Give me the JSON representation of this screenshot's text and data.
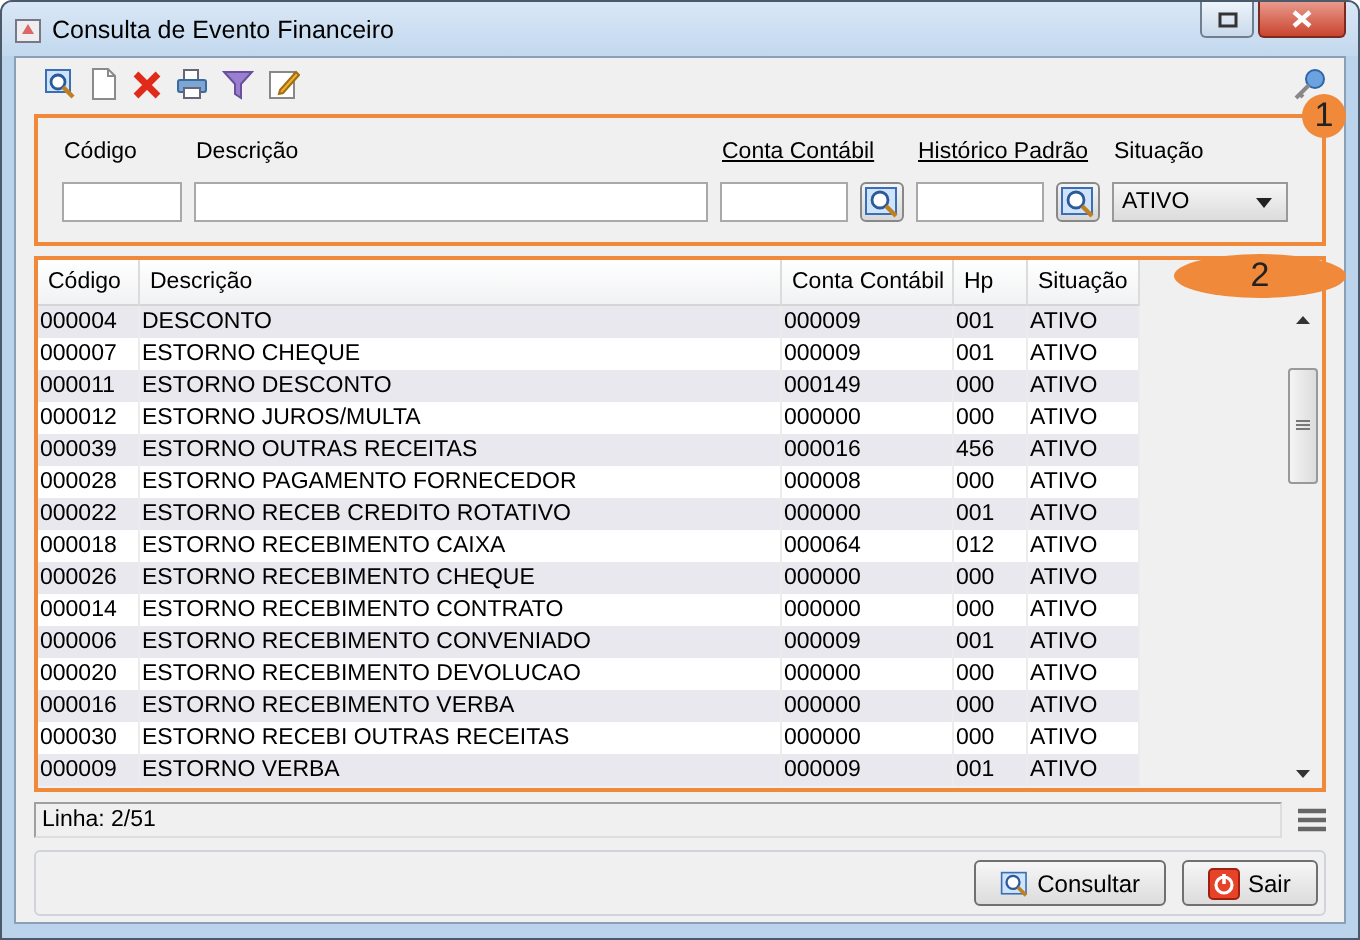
{
  "window": {
    "title": "Consulta de Evento Financeiro"
  },
  "filters": {
    "callout": "1",
    "fields": [
      {
        "kind": "text",
        "label": "Código",
        "link": false
      },
      {
        "kind": "text",
        "label": "Descrição",
        "link": false
      },
      {
        "kind": "lookup",
        "label": "Conta Contábil",
        "link": true
      },
      {
        "kind": "lookup",
        "label": "Histórico Padrão",
        "link": true
      },
      {
        "kind": "select",
        "label": "Situação",
        "link": false,
        "value": "ATIVO"
      }
    ]
  },
  "table": {
    "callout": "2",
    "columns": [
      "Código",
      "Descrição",
      "Conta Contábil",
      "Hp",
      "Situação"
    ],
    "rows": [
      [
        "000004",
        "DESCONTO",
        "000009",
        "001",
        "ATIVO"
      ],
      [
        "000007",
        "ESTORNO CHEQUE",
        "000009",
        "001",
        "ATIVO"
      ],
      [
        "000011",
        "ESTORNO DESCONTO",
        "000149",
        "000",
        "ATIVO"
      ],
      [
        "000012",
        "ESTORNO JUROS/MULTA",
        "000000",
        "000",
        "ATIVO"
      ],
      [
        "000039",
        "ESTORNO OUTRAS RECEITAS",
        "000016",
        "456",
        "ATIVO"
      ],
      [
        "000028",
        "ESTORNO PAGAMENTO FORNECEDOR",
        "000008",
        "000",
        "ATIVO"
      ],
      [
        "000022",
        "ESTORNO RECEB CREDITO ROTATIVO",
        "000000",
        "001",
        "ATIVO"
      ],
      [
        "000018",
        "ESTORNO RECEBIMENTO CAIXA",
        "000064",
        "012",
        "ATIVO"
      ],
      [
        "000026",
        "ESTORNO RECEBIMENTO CHEQUE",
        "000000",
        "000",
        "ATIVO"
      ],
      [
        "000014",
        "ESTORNO RECEBIMENTO CONTRATO",
        "000000",
        "000",
        "ATIVO"
      ],
      [
        "000006",
        "ESTORNO RECEBIMENTO CONVENIADO",
        "000009",
        "001",
        "ATIVO"
      ],
      [
        "000020",
        "ESTORNO RECEBIMENTO DEVOLUCAO",
        "000000",
        "000",
        "ATIVO"
      ],
      [
        "000016",
        "ESTORNO RECEBIMENTO VERBA",
        "000000",
        "000",
        "ATIVO"
      ],
      [
        "000030",
        "ESTORNO RECEBI OUTRAS RECEITAS",
        "000000",
        "000",
        "ATIVO"
      ],
      [
        "000009",
        "ESTORNO VERBA",
        "000009",
        "001",
        "ATIVO"
      ]
    ]
  },
  "status_bar": {
    "text": "Linha: 2/51"
  },
  "buttons": [
    {
      "kind": "search",
      "label": "Consultar"
    },
    {
      "kind": "exit",
      "label": "Sair"
    }
  ]
}
